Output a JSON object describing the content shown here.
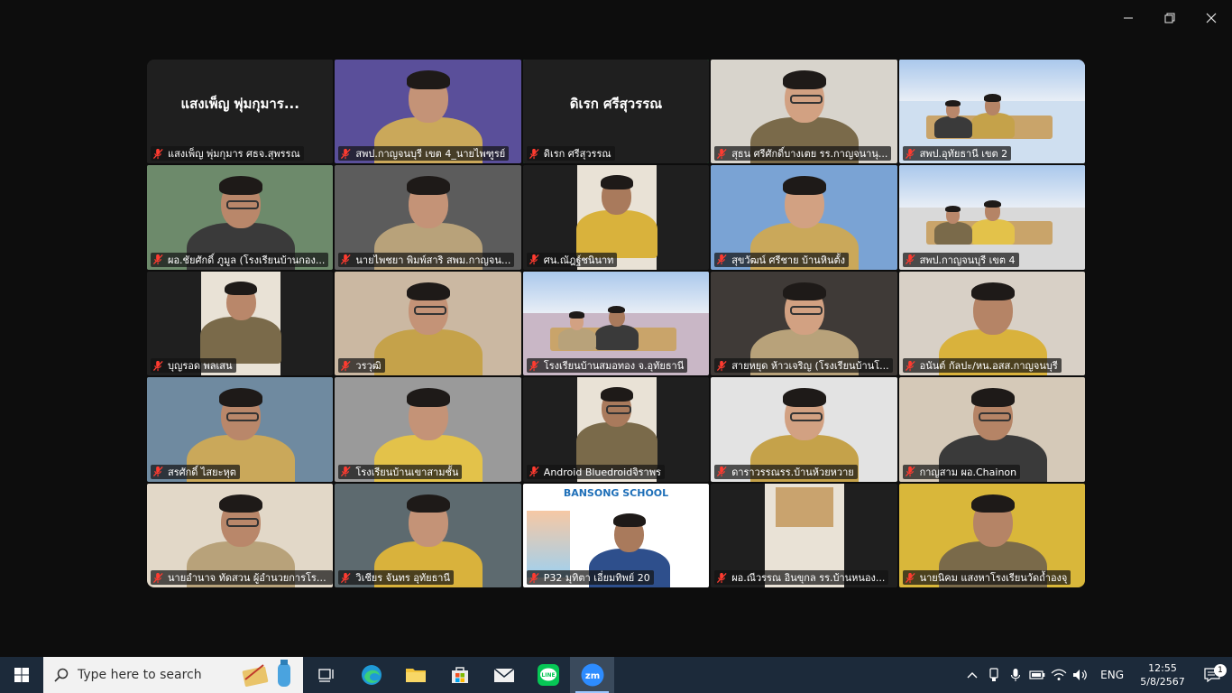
{
  "window": {
    "minimize": "—",
    "restore": "❐",
    "close": "✕"
  },
  "tiles": [
    {
      "label": "แสงเพ็ญ พุ่มกุมาร ศธจ.สุพรรณ",
      "center_name": "แสงเพ็ญ พุ่มกุมาร...",
      "bg": "#1f1f1f"
    },
    {
      "label": "สพป.กาญจนบุรี เขต 4_นายไพฑูรย์",
      "bg": "#5a4f9a"
    },
    {
      "label": "ดิเรก ศรีสุวรรณ",
      "center_name": "ดิเรก ศรีสุวรรณ",
      "bg": "#1f1f1f",
      "active": true
    },
    {
      "label": "สุธน ศรีศักดิ์บางเตย รร.กาญจนานุ...",
      "bg": "#d8d4cc"
    },
    {
      "label": "สพป.อุทัยธานี เขต 2",
      "bg": "#cfdff0"
    },
    {
      "label": "ผอ.ชัยศักดิ์ ภูมูล (โรงเรียนบ้านกอง...",
      "bg": "#6d8a6b"
    },
    {
      "label": "นายไพชยา พิมพ์สาริ สพม.กาญจน...",
      "bg": "#5c5c5c"
    },
    {
      "label": "ศน.ณัฎฐ์ชนินาท",
      "bg": "#1f1f1f"
    },
    {
      "label": "สุขวัฒน์ ศรีชาย บ้านหินตั้ง",
      "bg": "#7aa3d4"
    },
    {
      "label": "สพป.กาญจนบุรี เขต 4",
      "bg": "#d9d9d9"
    },
    {
      "label": "บุญรอด พลเสน",
      "bg": "#1f1f1f"
    },
    {
      "label": "วรวุฒิ",
      "bg": "#cbb8a2"
    },
    {
      "label": "โรงเรียนบ้านสมอทอง จ.อุทัยธานี",
      "bg": "#c9b7c6"
    },
    {
      "label": "สายหยุด ห้าวเจริญ (โรงเรียนบ้านโ...",
      "bg": "#3f3a37"
    },
    {
      "label": "อนันต์ กัลปะ/หน.อสส.กาญจนบุรี",
      "bg": "#d8d0c6"
    },
    {
      "label": "สรศักดิ์ ไสยะหุต",
      "bg": "#6f8aa0"
    },
    {
      "label": "โรงเรียนบ้านเขาสามชั้น",
      "bg": "#9a9a9a"
    },
    {
      "label": "Android Bluedroidจิราพร",
      "bg": "#1f1f1f"
    },
    {
      "label": "ดาราวรรณรร.บ้านห้วยหวาย",
      "bg": "#e3e3e3"
    },
    {
      "label": "กาญสาม ผอ.Chainon",
      "bg": "#d5c9b8"
    },
    {
      "label": "นายอำนาจ ทัดสวน ผู้อำนวยการโรง...",
      "bg": "#e2d8c8"
    },
    {
      "label": "วิเชียร จันทร อุทัยธานี",
      "bg": "#5d6a6f"
    },
    {
      "label": "P32 มุทิตา เอี่ยมทิพย์ 20",
      "bg": "#ffffff",
      "banner": "BANSONG SCHOOL"
    },
    {
      "label": "ผอ.ณีวรรณ อินขุกล รร.บ้านหนอง...",
      "bg": "#1f1f1f"
    },
    {
      "label": "นายนิคม แสงหาโรงเรียนวัดถ้ำองจุ",
      "bg": "#d9b73a"
    }
  ],
  "taskbar": {
    "search_placeholder": "Type here to search",
    "apps": [
      "task-view",
      "edge",
      "file-explorer",
      "microsoft-store",
      "mail",
      "line",
      "zoom"
    ],
    "zoom_label": "zm",
    "line_label": "LINE",
    "language": "ENG",
    "time": "12:55",
    "date": "5/8/2567",
    "notification_count": "1"
  }
}
